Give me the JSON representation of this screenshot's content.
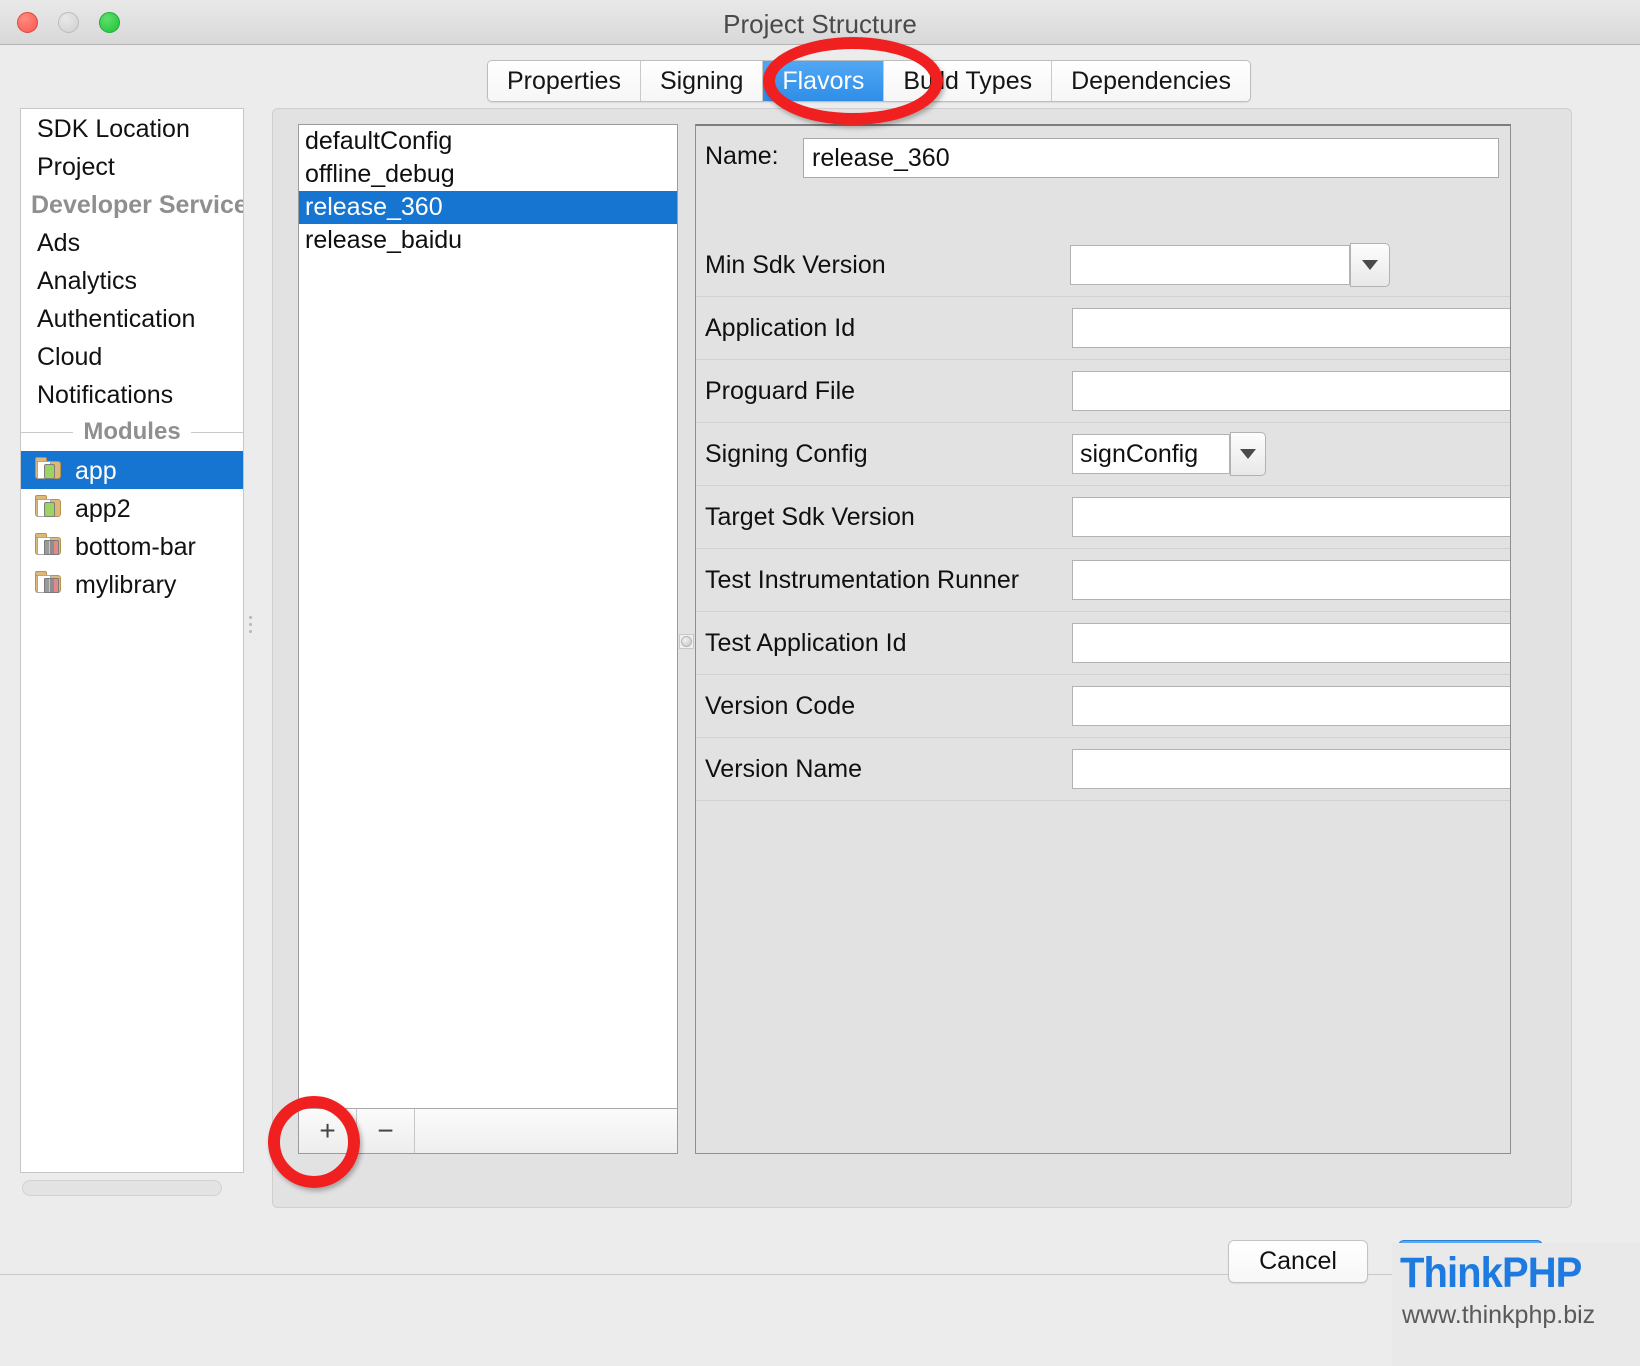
{
  "window": {
    "title": "Project Structure",
    "traffic_lights": [
      "close",
      "minimize",
      "maximize"
    ]
  },
  "sidebar": {
    "toolbar": {
      "add_label": "+",
      "remove_label": "−"
    },
    "items": [
      {
        "label": "SDK Location",
        "type": "item",
        "selected": false
      },
      {
        "label": "Project",
        "type": "item",
        "selected": false
      },
      {
        "label": "Developer Service",
        "type": "group",
        "selected": false
      },
      {
        "label": "Ads",
        "type": "item",
        "selected": false
      },
      {
        "label": "Analytics",
        "type": "item",
        "selected": false
      },
      {
        "label": "Authentication",
        "type": "item",
        "selected": false
      },
      {
        "label": "Cloud",
        "type": "item",
        "selected": false
      },
      {
        "label": "Notifications",
        "type": "item",
        "selected": false
      },
      {
        "label": "Modules",
        "type": "group-centered",
        "selected": false
      },
      {
        "label": "app",
        "type": "module-app",
        "selected": true
      },
      {
        "label": "app2",
        "type": "module-app",
        "selected": false
      },
      {
        "label": "bottom-bar",
        "type": "module-lib",
        "selected": false
      },
      {
        "label": "mylibrary",
        "type": "module-lib",
        "selected": false
      }
    ]
  },
  "tabs": [
    {
      "label": "Properties",
      "active": false
    },
    {
      "label": "Signing",
      "active": false
    },
    {
      "label": "Flavors",
      "active": true
    },
    {
      "label": "Build Types",
      "active": false
    },
    {
      "label": "Dependencies",
      "active": false
    }
  ],
  "flavors": {
    "items": [
      {
        "label": "defaultConfig",
        "selected": false
      },
      {
        "label": "offline_debug",
        "selected": false
      },
      {
        "label": "release_360",
        "selected": true
      },
      {
        "label": "release_baidu",
        "selected": false
      }
    ],
    "toolbar": {
      "add_label": "+",
      "remove_label": "−"
    }
  },
  "details": {
    "name_label": "Name:",
    "name_value": "release_360",
    "fields": [
      {
        "label": "Min Sdk Version",
        "value": "",
        "control": "combo"
      },
      {
        "label": "Application Id",
        "value": "",
        "control": "text"
      },
      {
        "label": "Proguard File",
        "value": "",
        "control": "text"
      },
      {
        "label": "Signing Config",
        "value": "signConfig",
        "control": "combo-small"
      },
      {
        "label": "Target Sdk Version",
        "value": "",
        "control": "text"
      },
      {
        "label": "Test Instrumentation Runner",
        "value": "",
        "control": "text"
      },
      {
        "label": "Test Application Id",
        "value": "",
        "control": "text"
      },
      {
        "label": "Version Code",
        "value": "",
        "control": "text"
      },
      {
        "label": "Version Name",
        "value": "",
        "control": "text"
      }
    ]
  },
  "footer": {
    "cancel_label": "Cancel",
    "ok_label": ""
  },
  "watermark": {
    "logo": "ThinkPHP",
    "url": "www.thinkphp.biz"
  },
  "annotations": [
    {
      "name": "flavors-tab-highlight",
      "shape": "ellipse"
    },
    {
      "name": "add-flavor-highlight",
      "shape": "circle"
    }
  ],
  "colors": {
    "selection_blue": "#1675d1",
    "tab_active_blue": "#2f8ee8",
    "annotation_red": "#f02020",
    "window_bg": "#ececec",
    "panel_bg": "#e2e2e2",
    "logo_blue": "#1d7ae0"
  }
}
